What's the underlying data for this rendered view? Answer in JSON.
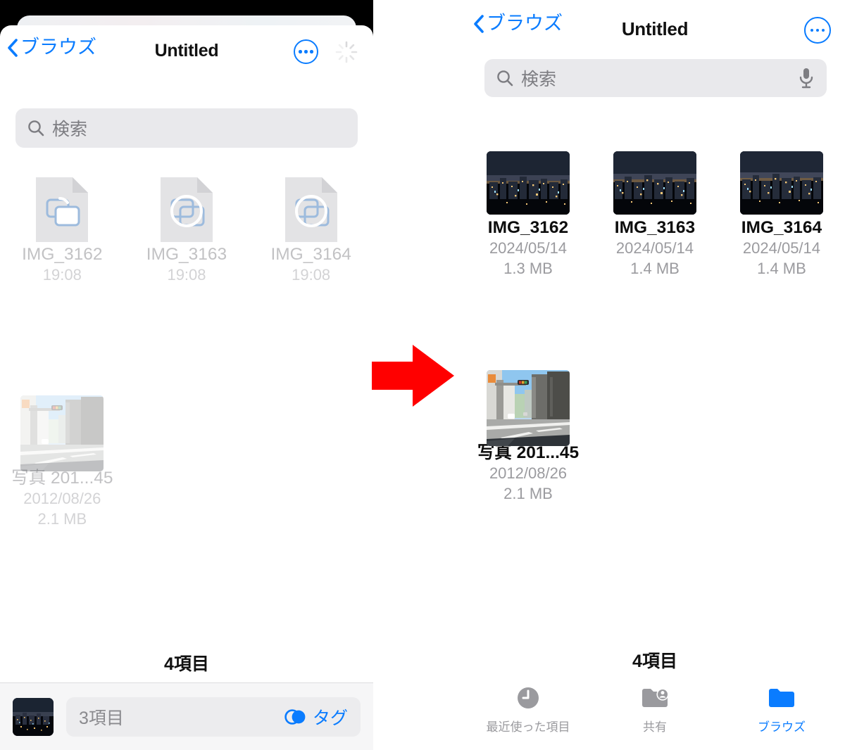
{
  "theme": {
    "accent": "#0a7cff",
    "arrow_color": "#ff0000",
    "faded_text": "#c2c2c4",
    "primary_text": "#0d0d0d",
    "secondary_text": "#9b9b9f",
    "search_bg": "#e9e9ec"
  },
  "left": {
    "nav": {
      "back_label": "ブラウズ",
      "title": "Untitled",
      "more_icon": "ellipsis-circle-icon",
      "spinner_icon": "activity-spinner-icon"
    },
    "search": {
      "placeholder": "検索",
      "icon": "search-icon"
    },
    "files": [
      {
        "name": "IMG_3162",
        "meta1": "19:08",
        "meta2": "",
        "kind": "placeholder"
      },
      {
        "name": "IMG_3163",
        "meta1": "19:08",
        "meta2": "",
        "kind": "placeholder"
      },
      {
        "name": "IMG_3164",
        "meta1": "19:08",
        "meta2": "",
        "kind": "placeholder"
      },
      {
        "name": "写真 201...45",
        "meta1": "2012/08/26",
        "meta2": "2.1 MB",
        "kind": "photo-street"
      }
    ],
    "count_label": "4項目",
    "dragbar": {
      "thumb_icon": "night-cityscape-thumbnail",
      "field_text": "3項目",
      "tag_label": "タグ",
      "tag_icon": "tags-icon"
    }
  },
  "arrow": {
    "name": "red-right-arrow",
    "direction": "right",
    "color": "#ff0000"
  },
  "right": {
    "nav": {
      "back_label": "ブラウズ",
      "title": "Untitled",
      "more_icon": "ellipsis-circle-icon"
    },
    "search": {
      "placeholder": "検索",
      "icon": "search-icon",
      "mic_icon": "microphone-icon"
    },
    "files": [
      {
        "name": "IMG_3162",
        "meta1": "2024/05/14",
        "meta2": "1.3 MB",
        "kind": "night"
      },
      {
        "name": "IMG_3163",
        "meta1": "2024/05/14",
        "meta2": "1.4 MB",
        "kind": "night"
      },
      {
        "name": "IMG_3164",
        "meta1": "2024/05/14",
        "meta2": "1.4 MB",
        "kind": "night"
      },
      {
        "name": "写真 201...45",
        "meta1": "2012/08/26",
        "meta2": "2.1 MB",
        "kind": "photo-street"
      }
    ],
    "count_label": "4項目",
    "tabs": [
      {
        "label": "最近使った項目",
        "icon": "clock-icon",
        "active": false
      },
      {
        "label": "共有",
        "icon": "shared-folder-icon",
        "active": false
      },
      {
        "label": "ブラウズ",
        "icon": "folder-icon",
        "active": true
      }
    ]
  }
}
